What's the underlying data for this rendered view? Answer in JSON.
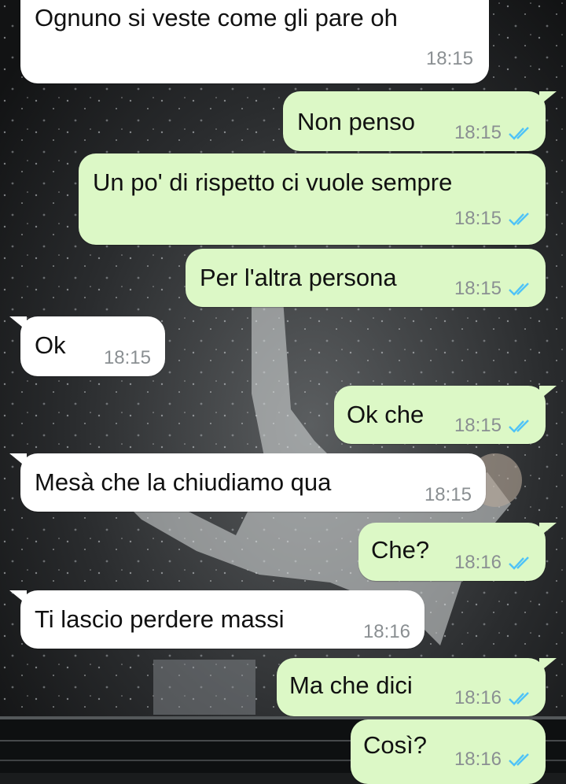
{
  "chat": {
    "messages": [
      {
        "side": "in",
        "text": "Ognuno si veste come gli pare oh",
        "time": "18:15"
      },
      {
        "side": "out",
        "text": "Non penso",
        "time": "18:15",
        "read": true
      },
      {
        "side": "out",
        "text": "Un po' di rispetto ci vuole sempre",
        "time": "18:15",
        "read": true
      },
      {
        "side": "out",
        "text": "Per l'altra persona",
        "time": "18:15",
        "read": true
      },
      {
        "side": "in",
        "text": "Ok",
        "time": "18:15"
      },
      {
        "side": "out",
        "text": "Ok che",
        "time": "18:15",
        "read": true
      },
      {
        "side": "in",
        "text": "Mesà che la chiudiamo qua",
        "time": "18:15"
      },
      {
        "side": "out",
        "text": "Che?",
        "time": "18:16",
        "read": true
      },
      {
        "side": "in",
        "text": "Ti lascio perdere massi",
        "time": "18:16"
      },
      {
        "side": "out",
        "text": "Ma che dici",
        "time": "18:16",
        "read": true
      },
      {
        "side": "out",
        "text": "Così?",
        "time": "18:16",
        "read": true
      }
    ]
  },
  "colors": {
    "incoming_bubble": "#ffffff",
    "outgoing_bubble": "#dcf8c6",
    "read_ticks": "#4fc3f7",
    "timestamp": "#8a8f92"
  },
  "icons": {
    "read_receipt": "double-check-icon"
  }
}
